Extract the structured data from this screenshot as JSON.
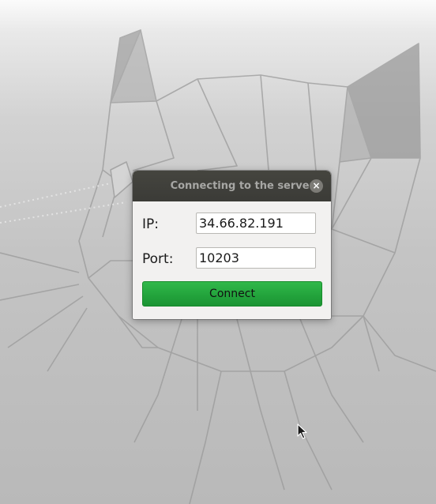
{
  "dialog": {
    "title": "Connecting to the server",
    "close_symbol": "×",
    "ip_label": "IP:",
    "ip_value": "34.66.82.191",
    "port_label": "Port:",
    "port_value": "10203",
    "connect_label": "Connect"
  },
  "icons": {
    "close": "close-icon",
    "cursor": "mouse-pointer-icon",
    "wallpaper": "geometric-cat-wallpaper"
  },
  "colors": {
    "titlebar": "#3b3b37",
    "title_text": "#a7a7a4",
    "connect_button": "#22a23b",
    "dialog_body": "#f2f1f0"
  }
}
